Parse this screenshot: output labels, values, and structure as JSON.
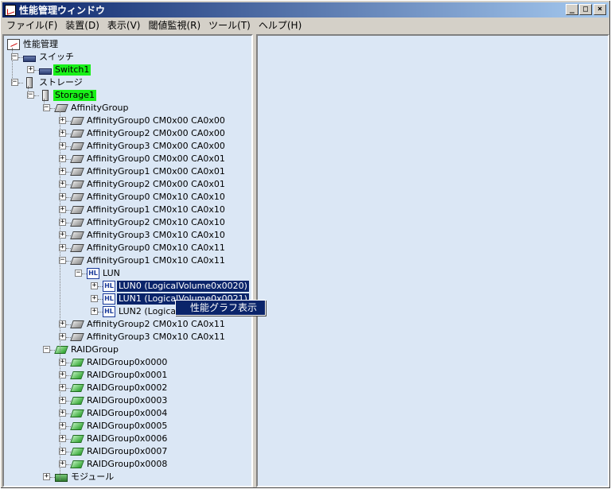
{
  "window": {
    "title": "性能管理ウィンドウ"
  },
  "menubar": [
    "ファイル(F)",
    "装置(D)",
    "表示(V)",
    "閾値監視(R)",
    "ツール(T)",
    "ヘルプ(H)"
  ],
  "tree": {
    "root": "性能管理",
    "switch_group": "スイッチ",
    "switch1": "Switch1",
    "storage_group": "ストレージ",
    "storage1": "Storage1",
    "affinity_group": "AffinityGroup",
    "affinity_items_top": [
      "AffinityGroup0 CM0x00 CA0x00",
      "AffinityGroup2 CM0x00 CA0x00",
      "AffinityGroup3 CM0x00 CA0x00",
      "AffinityGroup0 CM0x00 CA0x01",
      "AffinityGroup1 CM0x00 CA0x01",
      "AffinityGroup2 CM0x00 CA0x01",
      "AffinityGroup0 CM0x10 CA0x10",
      "AffinityGroup1 CM0x10 CA0x10",
      "AffinityGroup2 CM0x10 CA0x10",
      "AffinityGroup3 CM0x10 CA0x10",
      "AffinityGroup0 CM0x10 CA0x11",
      "AffinityGroup1 CM0x10 CA0x11"
    ],
    "lun_group": "LUN",
    "lun_items": [
      "LUN0 (LogicalVolume0x0020)",
      "LUN1 (LogicalVolume0x0021)",
      "LUN2 (LogicalV"
    ],
    "affinity_items_bottom": [
      "AffinityGroup2 CM0x10 CA0x11",
      "AffinityGroup3 CM0x10 CA0x11"
    ],
    "raid_group": "RAIDGroup",
    "raid_items": [
      "RAIDGroup0x0000",
      "RAIDGroup0x0001",
      "RAIDGroup0x0002",
      "RAIDGroup0x0003",
      "RAIDGroup0x0004",
      "RAIDGroup0x0005",
      "RAIDGroup0x0006",
      "RAIDGroup0x0007",
      "RAIDGroup0x0008"
    ],
    "module_group": "モジュール"
  },
  "context_menu": {
    "item": "性能グラフ表示"
  },
  "icons": {
    "root": "performance-chart-icon",
    "switch": "switch-icon",
    "storage": "storage-icon",
    "affinity": "affinity-group-icon",
    "lun": "lun-icon",
    "raid": "raid-group-icon",
    "module": "module-icon"
  },
  "colors": {
    "highlight_green": "#19f019",
    "selection": "#0a246a",
    "pane_bg": "#dbe7f5"
  }
}
